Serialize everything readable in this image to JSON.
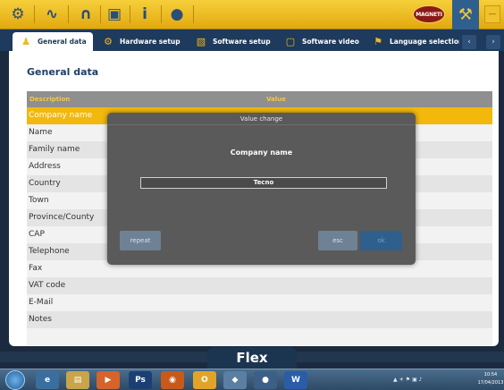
{
  "toolbar": {
    "icons": [
      "vehicle-selection-icon",
      "diagnosis-icon",
      "connection-icon",
      "folder-icon",
      "info-icon",
      "globe-icon"
    ],
    "logo_text": "MAGNETI MARELLI",
    "tool_icon": "tools-icon",
    "minimize_icon": "minimize-icon"
  },
  "tabs": [
    {
      "label": "General data",
      "icon": "people-icon",
      "active": true
    },
    {
      "label": "Hardware setup",
      "icon": "gear-icon",
      "active": false
    },
    {
      "label": "Software setup",
      "icon": "document-icon",
      "active": false
    },
    {
      "label": "Software video",
      "icon": "video-icon",
      "active": false
    },
    {
      "label": "Language selection",
      "icon": "flag-icon",
      "active": false
    }
  ],
  "page": {
    "title": "General data"
  },
  "table": {
    "headers": {
      "description": "Description",
      "value": "Value"
    },
    "rows": [
      "Company name",
      "Name",
      "Family name",
      "Address",
      "Country",
      "Town",
      "Province/County",
      "CAP",
      "Telephone",
      "Fax",
      "VAT code",
      "E-Mail",
      "Notes",
      ""
    ],
    "selected_index": 0
  },
  "dialog": {
    "title": "Value change",
    "field_label": "Company name",
    "input_value": "Tecno",
    "repeat_label": "repeat",
    "esc_label": "esc",
    "ok_label": "ok"
  },
  "brand": "Flex",
  "taskbar": {
    "apps": [
      "internet-explorer-icon",
      "folder-icon",
      "media-player-icon",
      "photoshop-icon",
      "firefox-icon",
      "outlook-icon",
      "app-icon",
      "app-icon",
      "word-icon"
    ],
    "clock_time": "10:54",
    "clock_date": "17/04/2013"
  },
  "colors": {
    "accent_yellow": "#f2b80c",
    "nav_blue": "#1e3a5c",
    "dialog_gray": "#5a5a5a"
  }
}
